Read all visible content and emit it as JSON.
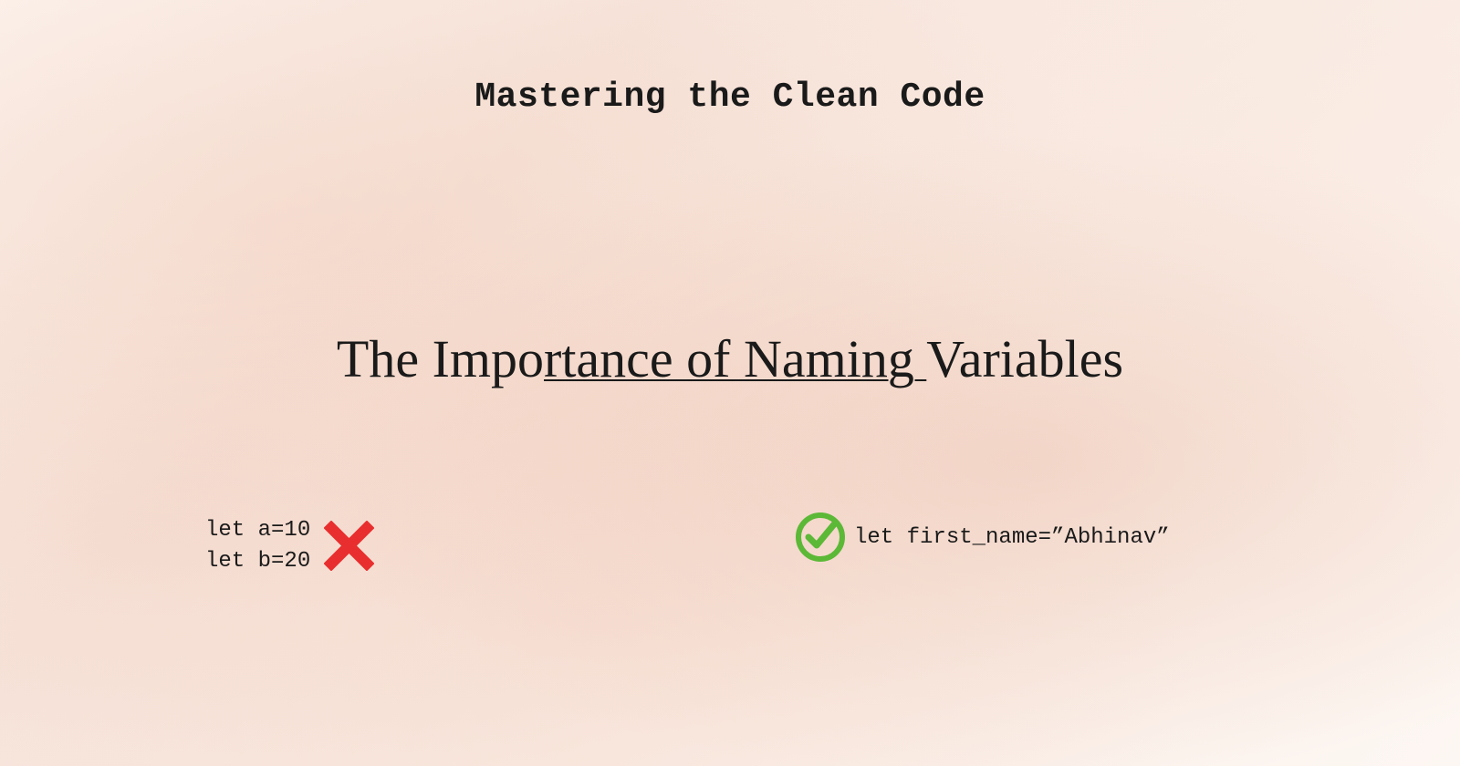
{
  "header": {
    "title": "Mastering the Clean Code"
  },
  "main": {
    "title_prefix": "The Impo",
    "title_underlined": "rtance of Naming ",
    "title_suffix": "Variables"
  },
  "examples": {
    "bad": {
      "line1": "let a=10",
      "line2": "let b=20"
    },
    "good": {
      "code": "let first_name=”Abhinav”"
    }
  },
  "icons": {
    "cross": "cross-icon",
    "check": "check-icon"
  },
  "colors": {
    "cross": "#e82e2e",
    "check": "#5cb837",
    "text": "#1a1a1a"
  }
}
